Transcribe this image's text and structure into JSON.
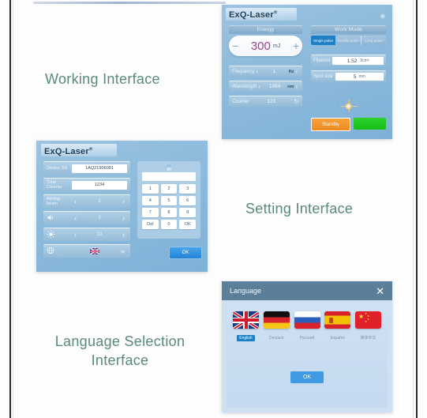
{
  "captions": {
    "working": "Working Interface",
    "setting": "Setting Interface",
    "language_line1": "Language Selection",
    "language_line2": "Interface"
  },
  "colors": {
    "caption_text": "#5a8a75",
    "panel_blue": "#8fbcdd",
    "accent_blue": "#1e7fc4",
    "energy_value": "#9c3f93",
    "standby_orange": "#ef8b20",
    "ready_green": "#14c114",
    "titlebar_slate": "#5c7f99"
  },
  "working": {
    "brand": "ExQ-Laser",
    "brand_mark": "®",
    "gear_icon": "gear-icon",
    "energy": {
      "header": "Energy",
      "value": "300",
      "unit": "mJ",
      "minus": "−",
      "plus": "+"
    },
    "frequency": {
      "label": "Frequency",
      "value": "1",
      "unit": "Hz",
      "left": "‹",
      "right": "›"
    },
    "wavelength": {
      "label": "Wavelength",
      "value": "1064",
      "unit": "nm",
      "left": "‹",
      "right": "›"
    },
    "counter": {
      "label": "Counter",
      "value": "123",
      "reset_icon": "refresh-icon",
      "reset_glyph": "↻"
    },
    "work_mode": {
      "header": "Work Mode",
      "tabs": [
        {
          "label": "Single pulse",
          "selected": true
        },
        {
          "label": "Double pulse",
          "selected": false
        },
        {
          "label": "Long pulse",
          "selected": false
        }
      ]
    },
    "fluence": {
      "label": "Fluence",
      "value": "1.52",
      "unit": "J/cm²"
    },
    "spot_size": {
      "label": "Spot size",
      "value": "5",
      "unit": "mm"
    },
    "aiming_indicator": "aiming-beam-icon",
    "standby_button": "Standby",
    "ready_button": ""
  },
  "setting": {
    "brand": "ExQ-Laser",
    "brand_mark": "®",
    "device_sn": {
      "label": "Device SN",
      "value": "1AQ21906001"
    },
    "total_counter": {
      "label": "Total Counter",
      "value": "1234"
    },
    "aiming_beam": {
      "label": "Aiming beam",
      "value": "3",
      "left": "‹",
      "right": "›"
    },
    "volume": {
      "icon": "speaker-icon",
      "value": "3",
      "left": "‹",
      "right": "›"
    },
    "brightness": {
      "icon": "brightness-icon",
      "value": "10",
      "left": "‹",
      "right": "›"
    },
    "language_row": {
      "icon": "globe-icon",
      "flag": "uk-flag-icon",
      "more": "»"
    },
    "keypad": {
      "lock_icon": "lock-icon",
      "display_value": "",
      "keys": [
        "1",
        "2",
        "3",
        "4",
        "5",
        "6",
        "7",
        "8",
        "9",
        "Del",
        "0",
        "OK"
      ]
    },
    "ok_button": "OK"
  },
  "language": {
    "title": "Language",
    "close_icon": "close-icon",
    "close_glyph": "✕",
    "options": [
      {
        "name": "English",
        "flag": "uk-flag-icon",
        "selected": true
      },
      {
        "name": "Deutsch",
        "flag": "germany-flag-icon",
        "selected": false
      },
      {
        "name": "Русский",
        "flag": "russia-flag-icon",
        "selected": false
      },
      {
        "name": "Español",
        "flag": "spain-flag-icon",
        "selected": false
      },
      {
        "name": "简体中文",
        "flag": "china-flag-icon",
        "selected": false
      }
    ],
    "ok_button": "OK"
  }
}
